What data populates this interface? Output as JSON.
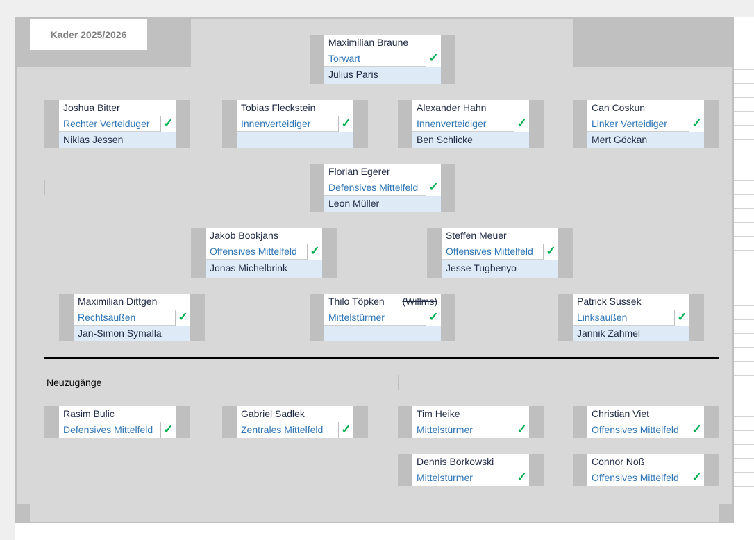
{
  "title": "Kader 2025/2026",
  "check_glyph": "✓",
  "colors": {
    "board": "#d8d8d8",
    "bar": "#bfbfbf",
    "position_text": "#2e75b6",
    "check": "#00b050",
    "backup_bg": "#deebf7"
  },
  "lineup": {
    "gk": {
      "name": "Maximilian Braune",
      "position": "Torwart",
      "backup": "Julius Paris",
      "checked": true
    },
    "rb": {
      "name": "Joshua Bitter",
      "position": "Rechter Verteiduger",
      "backup": "Niklas Jessen",
      "checked": true
    },
    "cb1": {
      "name": "Tobias Fleckstein",
      "position": "Innenverteidiger",
      "backup": "",
      "checked": true
    },
    "cb2": {
      "name": "Alexander Hahn",
      "position": "Innenverteidiger",
      "backup": "Ben Schlicke",
      "checked": true
    },
    "lb": {
      "name": "Can Coskun",
      "position": "Linker Verteidiger",
      "backup": "Mert Göckan",
      "checked": true
    },
    "dm": {
      "name": "Florian Egerer",
      "position": "Defensives Mittelfeld",
      "backup": "Leon Müller",
      "checked": true
    },
    "om1": {
      "name": "Jakob Bookjans",
      "position": "Offensives Mittelfeld",
      "backup": "Jonas Michelbrink",
      "checked": true
    },
    "om2": {
      "name": "Steffen Meuer",
      "position": "Offensives Mittelfeld",
      "backup": "Jesse Tugbenyo",
      "checked": true
    },
    "rw": {
      "name": "Maximilian Dittgen",
      "position": "Rechtsaußen",
      "backup": "Jan-Simon Symalla",
      "checked": true
    },
    "st": {
      "name": "Thilo Töpken",
      "name_note": "(Willms)",
      "position": "Mittelstürmer",
      "backup": "",
      "checked": true
    },
    "lw": {
      "name": "Patrick Sussek",
      "position": "Linksaußen",
      "backup": "Jannik Zahmel",
      "checked": true
    }
  },
  "new_signings_label": "Neuzugänge",
  "new_signings": [
    {
      "name": "Rasim Bulic",
      "position": "Defensives Mittelfeld",
      "checked": true
    },
    {
      "name": "Gabriel Sadlek",
      "position": "Zentrales Mittelfeld",
      "checked": true
    },
    {
      "name": "Tim Heike",
      "position": "Mittelstürmer",
      "checked": true
    },
    {
      "name": "Christian Viet",
      "position": "Offensives Mittelfeld",
      "checked": true
    },
    {
      "name": "Dennis Borkowski",
      "position": "Mittelstürmer",
      "checked": true
    },
    {
      "name": "Connor Noß",
      "position": "Offensives Mittelfeld",
      "checked": true
    }
  ]
}
